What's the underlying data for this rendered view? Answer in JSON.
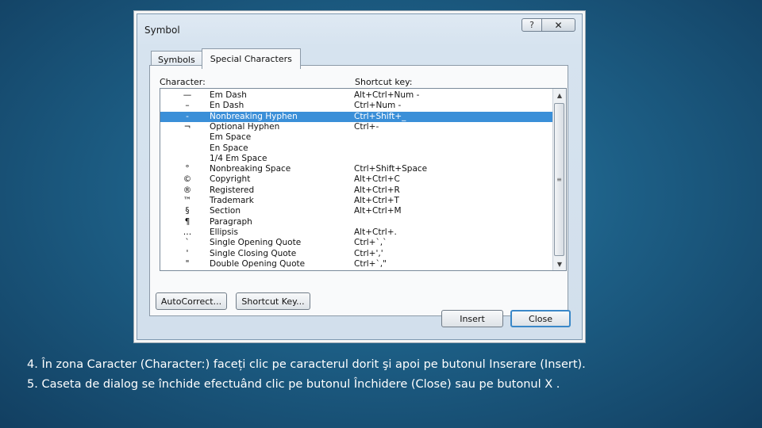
{
  "dialog": {
    "title": "Symbol",
    "help_label": "?",
    "close_label": "✕",
    "tabs": [
      {
        "label": "Symbols"
      },
      {
        "label": "Special Characters"
      }
    ],
    "column_character": "Character:",
    "column_shortcut": "Shortcut key:",
    "rows": [
      {
        "symbol": "—",
        "name": "Em Dash",
        "shortcut": "Alt+Ctrl+Num -"
      },
      {
        "symbol": "–",
        "name": "En Dash",
        "shortcut": "Ctrl+Num -"
      },
      {
        "symbol": "-",
        "name": "Nonbreaking Hyphen",
        "shortcut": "Ctrl+Shift+_"
      },
      {
        "symbol": "¬",
        "name": "Optional Hyphen",
        "shortcut": "Ctrl+-"
      },
      {
        "symbol": "",
        "name": "Em Space",
        "shortcut": ""
      },
      {
        "symbol": "",
        "name": "En Space",
        "shortcut": ""
      },
      {
        "symbol": "",
        "name": "1/4 Em Space",
        "shortcut": ""
      },
      {
        "symbol": "°",
        "name": "Nonbreaking Space",
        "shortcut": "Ctrl+Shift+Space"
      },
      {
        "symbol": "©",
        "name": "Copyright",
        "shortcut": "Alt+Ctrl+C"
      },
      {
        "symbol": "®",
        "name": "Registered",
        "shortcut": "Alt+Ctrl+R"
      },
      {
        "symbol": "™",
        "name": "Trademark",
        "shortcut": "Alt+Ctrl+T"
      },
      {
        "symbol": "§",
        "name": "Section",
        "shortcut": "Alt+Ctrl+M"
      },
      {
        "symbol": "¶",
        "name": "Paragraph",
        "shortcut": ""
      },
      {
        "symbol": "…",
        "name": "Ellipsis",
        "shortcut": "Alt+Ctrl+."
      },
      {
        "symbol": "`",
        "name": "Single Opening Quote",
        "shortcut": "Ctrl+`,`"
      },
      {
        "symbol": "'",
        "name": "Single Closing Quote",
        "shortcut": "Ctrl+',' "
      },
      {
        "symbol": "\"",
        "name": "Double Opening Quote",
        "shortcut": "Ctrl+`,\""
      }
    ],
    "selected_row": "Nonbreaking Hyphen",
    "autocorrect_label": "AutoCorrect...",
    "shortcut_key_label": "Shortcut Key...",
    "insert_label": "Insert",
    "close_button_label": "Close"
  },
  "caption": {
    "line1": "4. În zona Caracter (Character:) faceți clic pe caracterul dorit şi apoi pe butonul Inserare (Insert).",
    "line2": "5. Caseta de dialog se închide efectuând clic pe butonul Închidere (Close) sau pe butonul X ."
  },
  "icons": {
    "scroll_up": "triangle-up",
    "scroll_down": "triangle-down",
    "scroll_grip": "grip-lines"
  }
}
